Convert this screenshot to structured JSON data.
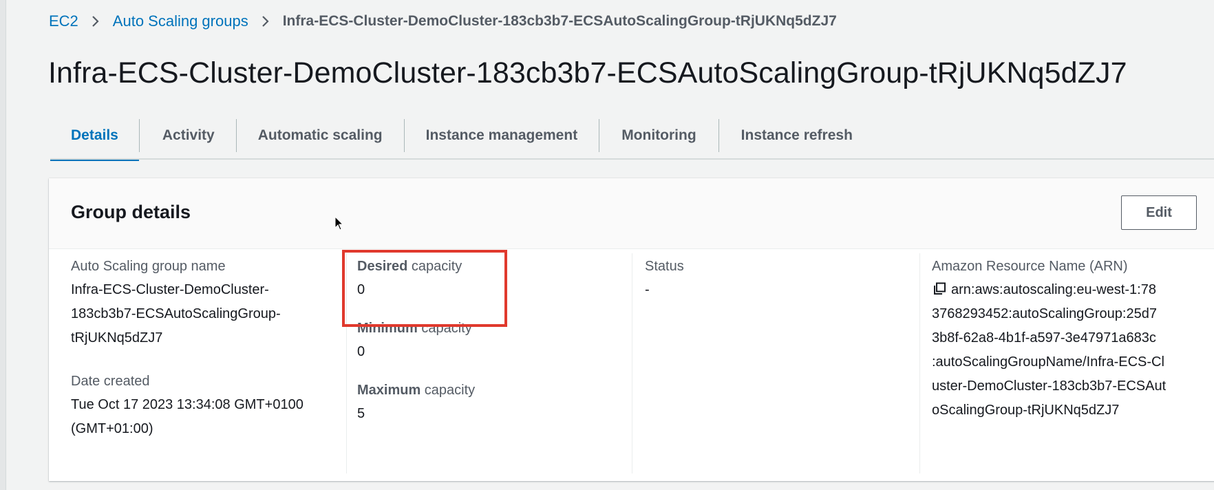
{
  "breadcrumb": {
    "items": [
      "EC2",
      "Auto Scaling groups"
    ],
    "current": "Infra-ECS-Cluster-DemoCluster-183cb3b7-ECSAutoScalingGroup-tRjUKNq5dZJ7"
  },
  "page_title": "Infra-ECS-Cluster-DemoCluster-183cb3b7-ECSAutoScalingGroup-tRjUKNq5dZJ7",
  "tabs": [
    {
      "label": "Details",
      "active": true
    },
    {
      "label": "Activity"
    },
    {
      "label": "Automatic scaling"
    },
    {
      "label": "Instance management"
    },
    {
      "label": "Monitoring"
    },
    {
      "label": "Instance refresh"
    }
  ],
  "group_details": {
    "title": "Group details",
    "edit_label": "Edit",
    "asg_name_label": "Auto Scaling group name",
    "asg_name_lines": [
      "Infra-ECS-Cluster-DemoCluster-",
      "183cb3b7-ECSAutoScalingGroup-",
      "tRjUKNq5dZJ7"
    ],
    "date_created_label": "Date created",
    "date_created_lines": [
      "Tue Oct 17 2023 13:34:08 GMT+0100",
      "(GMT+01:00)"
    ],
    "desired_label_bold": "Desired",
    "desired_label_rest": " capacity",
    "desired_value": "0",
    "minimum_label_bold": "Minimum",
    "minimum_label_rest": " capacity",
    "minimum_value": "0",
    "maximum_label_bold": "Maximum",
    "maximum_label_rest": " capacity",
    "maximum_value": "5",
    "status_label": "Status",
    "status_value": "-",
    "arn_label": "Amazon Resource Name (ARN)",
    "arn_lines": [
      "arn:aws:autoscaling:eu-west-1:78",
      "3768293452:autoScalingGroup:25d7",
      "3b8f-62a8-4b1f-a597-3e47971a683c",
      ":autoScalingGroupName/Infra-ECS-Cl",
      "uster-DemoCluster-183cb3b7-ECSAut",
      "oScalingGroup-tRjUKNq5dZJ7"
    ]
  },
  "colors": {
    "link": "#0073bb",
    "highlight": "#e0392d",
    "background": "#f2f3f3"
  },
  "icons": [
    "chevron-right-icon",
    "copy-icon",
    "mouse-cursor-icon"
  ]
}
